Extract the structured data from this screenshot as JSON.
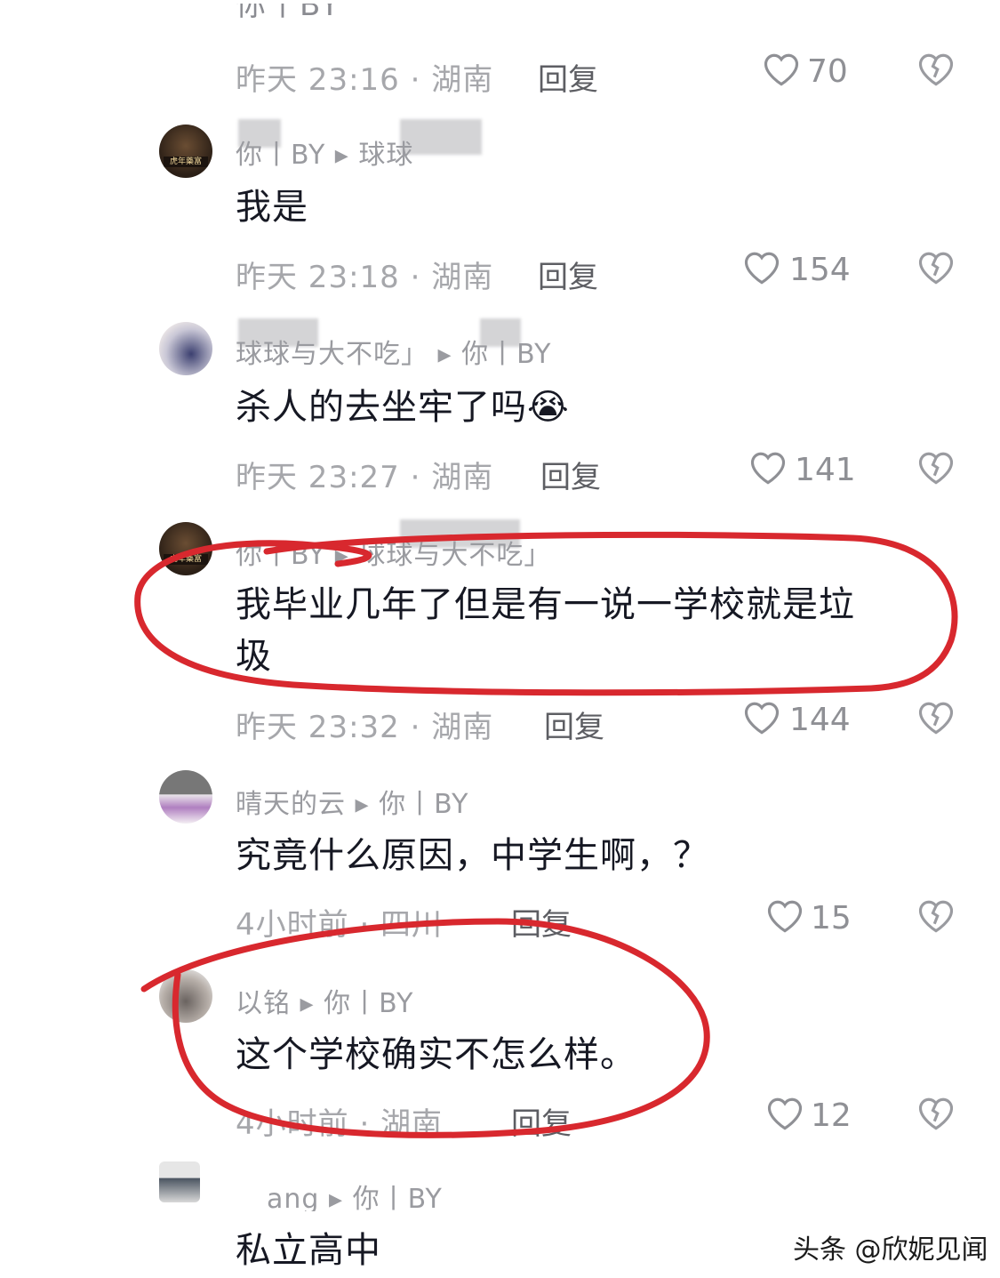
{
  "top_fragment": "你丨BY",
  "comments": [
    {
      "meta": "昨天 23:16 · 湖南",
      "reply": "回复",
      "likes": "70"
    },
    {
      "username": "你丨BY ▸ 球球",
      "text": "我是",
      "meta": "昨天 23:18 · 湖南",
      "reply": "回复",
      "likes": "154"
    },
    {
      "username": "球球与大不吃」 ▸ 你丨BY",
      "text": "杀人的去坐牢了吗",
      "emoji": "😭",
      "meta": "昨天 23:27 · 湖南",
      "reply": "回复",
      "likes": "141"
    },
    {
      "username": "你丨BY ▸ 球球与大不吃」",
      "text_line1": "我毕业几年了但是有一说一学校就是垃",
      "text_line2": "圾",
      "meta": "昨天 23:32 · 湖南",
      "reply": "回复",
      "likes": "144"
    },
    {
      "username": "晴天的云 ▸ 你丨BY",
      "text": "究竟什么原因，中学生啊，？",
      "meta": "4小时前 · 四川",
      "reply": "回复",
      "likes": "15"
    },
    {
      "username": "以铭 ▸ 你丨BY",
      "text": "这个学校确实不怎么样。",
      "meta": "4小时前 · 湖南",
      "reply": "回复",
      "likes": "12"
    },
    {
      "username": "ang ▸ 你丨BY",
      "text": "私立高中"
    }
  ],
  "watermark": "头条 @欣妮见闻",
  "icons": {
    "like": "heart-outline-icon",
    "dislike": "broken-heart-icon",
    "reply_arrow": "triangle-arrow-icon"
  },
  "colors": {
    "annotation": "#d8282e",
    "meta_text": "#a6a7ab",
    "body_text": "#161823"
  }
}
